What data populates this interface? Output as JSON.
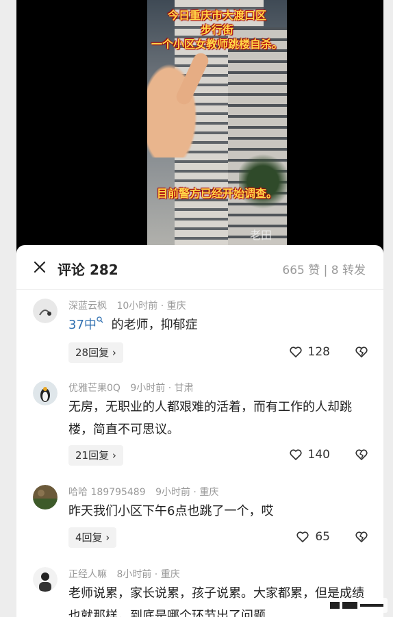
{
  "video": {
    "caption_top": "今日重庆市大渡口区\n步行街\n一个小区女教师跳楼自杀。",
    "caption_bottom": "目前警方已经开始调查。",
    "sign_text": "老田"
  },
  "comments_panel": {
    "title": "评论 282",
    "meta": "665 赞 | 8 转发"
  },
  "comments": [
    {
      "username": "深蓝云枫",
      "time_location": "10小时前 · 重庆",
      "text_link": "37中",
      "text": "的老师，抑郁症",
      "replies": "28回复",
      "likes": "128"
    },
    {
      "username": "优雅芒果0Q",
      "time_location": "9小时前 · 甘肃",
      "text": "无房，无职业的人都艰难的活着，而有工作的人却跳楼，简直不可思议。",
      "replies": "21回复",
      "likes": "140"
    },
    {
      "username": "哈哈 189795489",
      "time_location": "9小时前 · 重庆",
      "text": "昨天我们小区下午6点也跳了一个，哎",
      "replies": "4回复",
      "likes": "65"
    },
    {
      "username": "正经人嘛",
      "time_location": "8小时前 · 重庆",
      "text": "老师说累，家长说累，孩子说累。大家都累，但是成绩也就那样，到底是哪个环节出了问题"
    }
  ],
  "colors": {
    "link": "#2f6fb0",
    "meta_gray": "#9a9a9a",
    "caption_yellow": "#ffd84a"
  }
}
